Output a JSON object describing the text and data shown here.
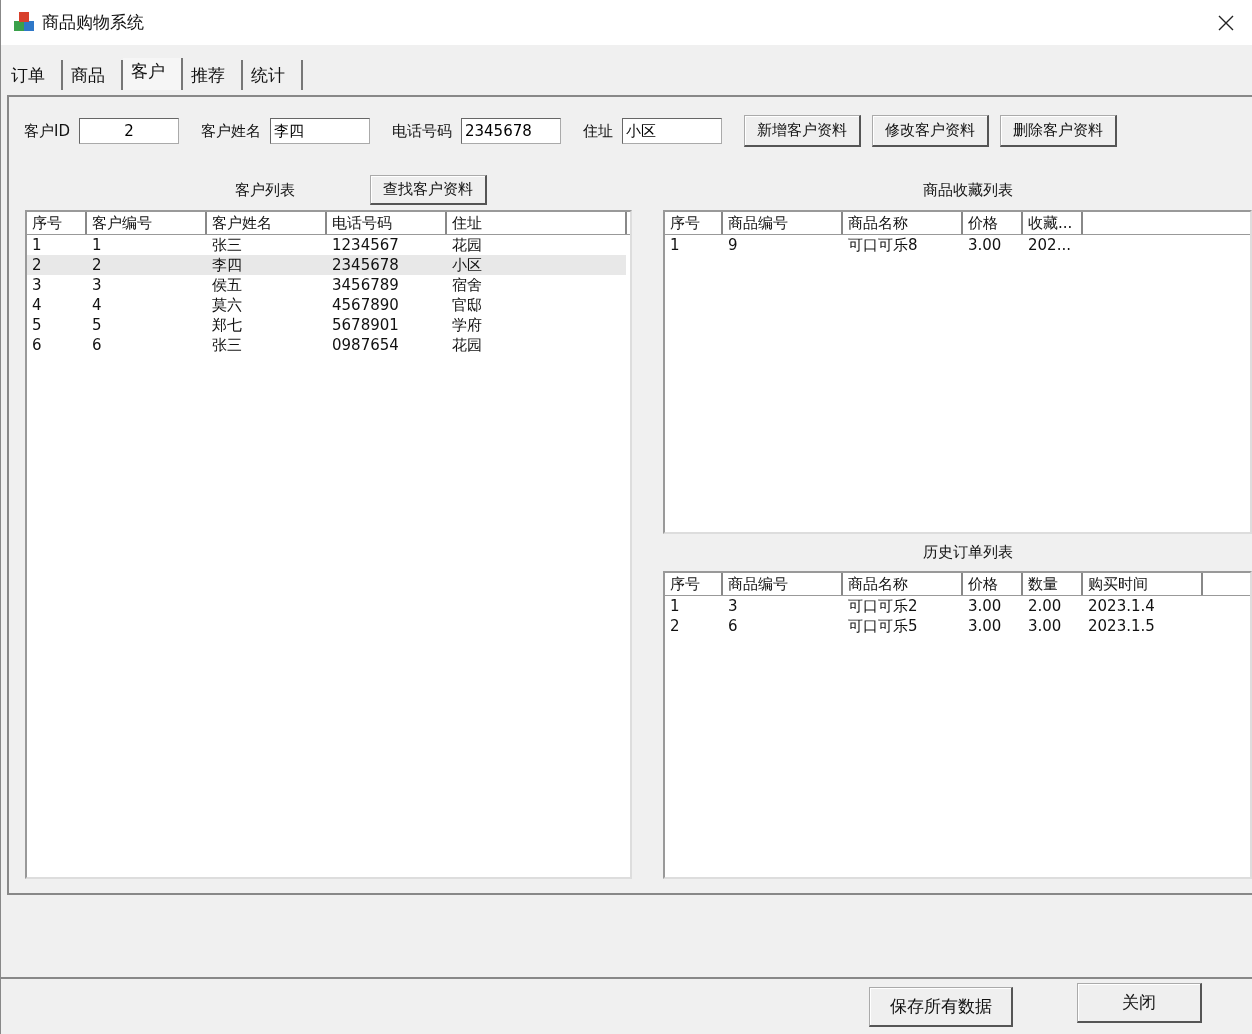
{
  "window": {
    "title": "商品购物系统"
  },
  "tabs": [
    {
      "label": "订单",
      "selected": false
    },
    {
      "label": "商品",
      "selected": false
    },
    {
      "label": "客户",
      "selected": true
    },
    {
      "label": "推荐",
      "selected": false
    },
    {
      "label": "统计",
      "selected": false
    }
  ],
  "form": {
    "fields": [
      {
        "label": "客户ID",
        "value": "2"
      },
      {
        "label": "客户姓名",
        "value": "李四"
      },
      {
        "label": "电话号码",
        "value": "2345678"
      },
      {
        "label": "住址",
        "value": "小区"
      }
    ],
    "buttons": [
      "新增客户资料",
      "修改客户资料",
      "删除客户资料"
    ]
  },
  "customer_list": {
    "title": "客户列表",
    "search_button": "查找客户资料",
    "columns": [
      "序号",
      "客户编号",
      "客户姓名",
      "电话号码",
      "住址"
    ],
    "rows": [
      {
        "cells": [
          "1",
          "1",
          "张三",
          "1234567",
          "花园"
        ],
        "selected": false
      },
      {
        "cells": [
          "2",
          "2",
          "李四",
          "2345678",
          "小区"
        ],
        "selected": true
      },
      {
        "cells": [
          "3",
          "3",
          "侯五",
          "3456789",
          "宿舍"
        ],
        "selected": false
      },
      {
        "cells": [
          "4",
          "4",
          "莫六",
          "4567890",
          "官邸"
        ],
        "selected": false
      },
      {
        "cells": [
          "5",
          "5",
          "郑七",
          "5678901",
          "学府"
        ],
        "selected": false
      },
      {
        "cells": [
          "6",
          "6",
          "张三",
          "0987654",
          "花园"
        ],
        "selected": false
      }
    ]
  },
  "favorites_list": {
    "title": "商品收藏列表",
    "columns": [
      "序号",
      "商品编号",
      "商品名称",
      "价格",
      "收藏..."
    ],
    "rows": [
      {
        "cells": [
          "1",
          "9",
          "可口可乐8",
          "3.00",
          "202..."
        ],
        "selected": false
      }
    ]
  },
  "order_history": {
    "title": "历史订单列表",
    "columns": [
      "序号",
      "商品编号",
      "商品名称",
      "价格",
      "数量",
      "购买时间"
    ],
    "rows": [
      {
        "cells": [
          "1",
          "3",
          "可口可乐2",
          "3.00",
          "2.00",
          "2023.1.4"
        ],
        "selected": false
      },
      {
        "cells": [
          "2",
          "6",
          "可口可乐5",
          "3.00",
          "3.00",
          "2023.1.5"
        ],
        "selected": false
      }
    ]
  },
  "footer_buttons": [
    "保存所有数据",
    "关闭"
  ]
}
